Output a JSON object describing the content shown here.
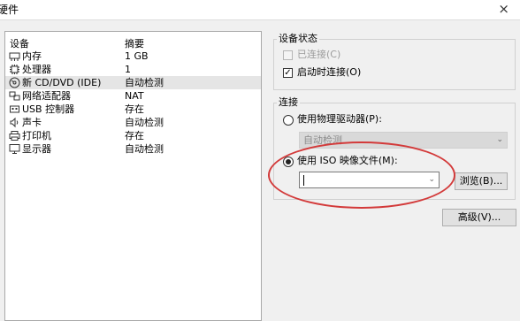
{
  "window": {
    "title": "硬件",
    "close_glyph": "×"
  },
  "device_list": {
    "headers": {
      "device": "设备",
      "summary": "摘要"
    },
    "items": [
      {
        "icon": "memory-icon",
        "name": "内存",
        "summary": "1 GB"
      },
      {
        "icon": "processor-icon",
        "name": "处理器",
        "summary": "1"
      },
      {
        "icon": "cd-dvd-icon",
        "name": "新 CD/DVD (IDE)",
        "summary": "自动检测",
        "selected": true
      },
      {
        "icon": "network-adapter-icon",
        "name": "网络适配器",
        "summary": "NAT"
      },
      {
        "icon": "usb-controller-icon",
        "name": "USB 控制器",
        "summary": "存在"
      },
      {
        "icon": "sound-card-icon",
        "name": "声卡",
        "summary": "自动检测"
      },
      {
        "icon": "printer-icon",
        "name": "打印机",
        "summary": "存在"
      },
      {
        "icon": "display-icon",
        "name": "显示器",
        "summary": "自动检测"
      }
    ]
  },
  "device_status": {
    "title": "设备状态",
    "connected_label": "已连接(C)",
    "connected_checked": false,
    "connect_at_power_on_label": "启动时连接(O)",
    "connect_at_power_on_checked": true
  },
  "connection": {
    "title": "连接",
    "physical_drive_label": "使用物理驱动器(P):",
    "physical_drive_value": "自动检测",
    "iso_label": "使用 ISO 映像文件(M):",
    "iso_value": "",
    "browse_label": "浏览(B)...",
    "selected_option": "iso"
  },
  "advanced_button_label": "高级(V)...",
  "colors": {
    "highlight_ellipse": "#d33a3a"
  }
}
